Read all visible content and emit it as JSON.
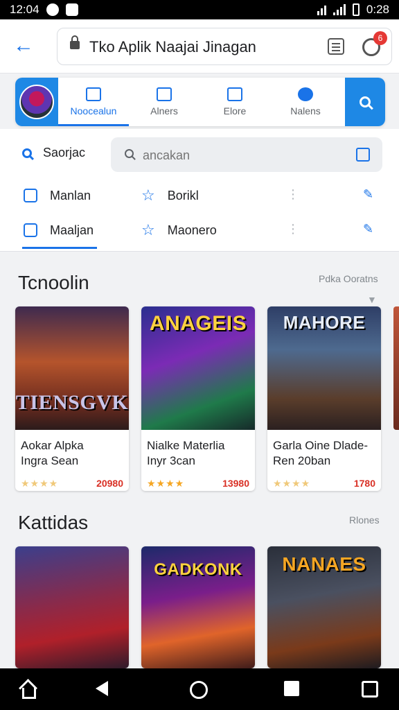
{
  "status_bar": {
    "time": "12:04",
    "clock": "0:28"
  },
  "top_bar": {
    "url": "Tko Aplik Naajai Jinagan",
    "notification_count": "6"
  },
  "nav_tabs": [
    {
      "label": "Noocealun",
      "icon": "store-icon"
    },
    {
      "label": "Alners",
      "icon": "tag-icon"
    },
    {
      "label": "Elore",
      "icon": "image-icon"
    },
    {
      "label": "Nalens",
      "icon": "profile-icon"
    }
  ],
  "search_row": {
    "label": "Saorjac",
    "placeholder": "ancakan"
  },
  "filter_rows": [
    {
      "left": "Manlan",
      "right": "Borikl"
    },
    {
      "left": "Maaljan",
      "right": "Maonero"
    }
  ],
  "section1": {
    "title": "Tcnoolin",
    "more": "Pdka Ooratns"
  },
  "section2": {
    "title": "Kattidas",
    "more": "Rlones"
  },
  "cards_row1": [
    {
      "art_title": "TIENSGVK",
      "name": "Aokar Alpka\nIngra Sean",
      "rating": "★★★★",
      "price": "20980"
    },
    {
      "art_title": "ANAGEIS",
      "name": "Nialke Materlia\nInyr 3can",
      "rating": "★★★★",
      "price": "13980"
    },
    {
      "art_title": "MAHORE",
      "name": "Garla Oine Dlade-\nRen 20ban",
      "rating": "★★★★",
      "price": "1780"
    }
  ],
  "cards_row2": [
    {
      "art_title": "",
      "name": "",
      "rating": "",
      "price": ""
    },
    {
      "art_title": "GADKONK",
      "name": "",
      "rating": "",
      "price": ""
    },
    {
      "art_title": "NANAES",
      "name": "",
      "rating": "",
      "price": ""
    }
  ],
  "colors": {
    "accent": "#1a73e8",
    "price": "#d93025",
    "star": "#f5a623"
  }
}
